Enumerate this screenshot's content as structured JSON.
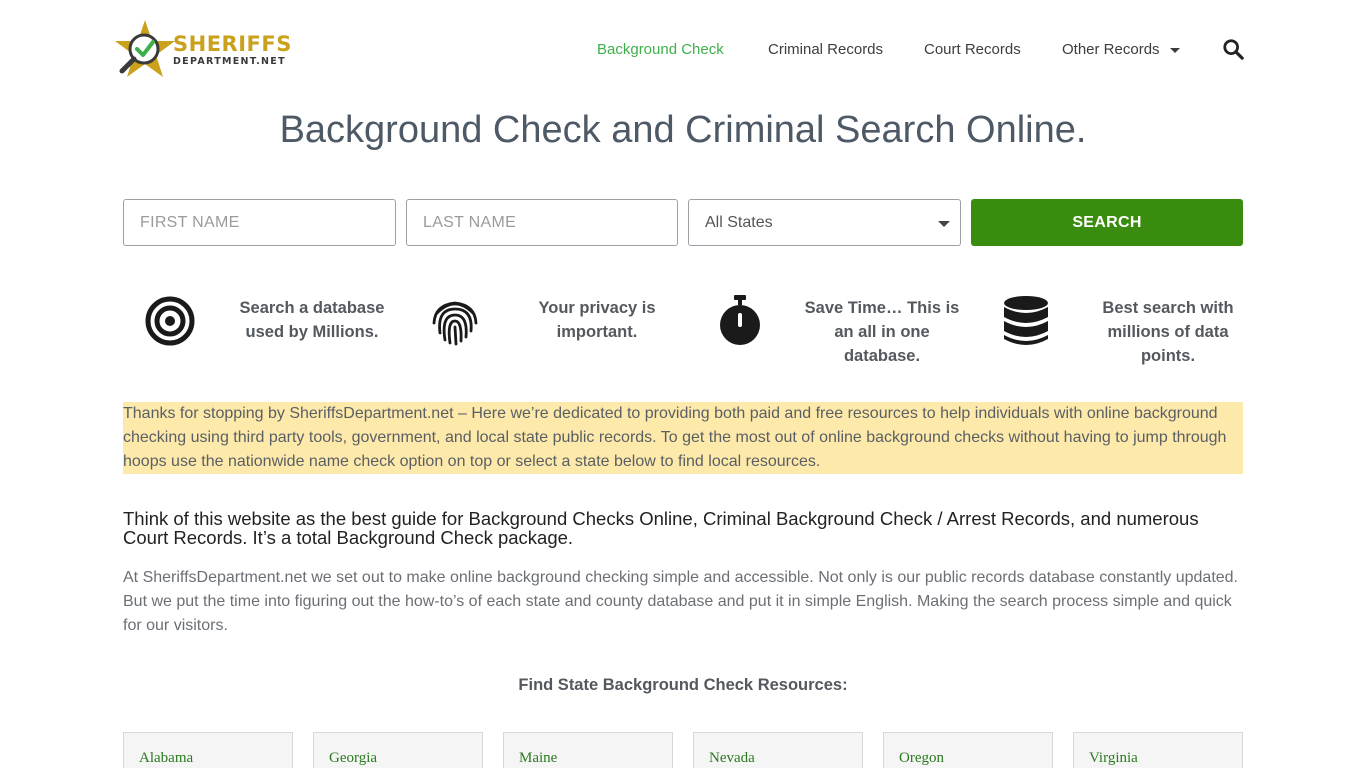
{
  "logo": {
    "main": "SHERIFFS",
    "sub": "DEPARTMENT.NET"
  },
  "nav": {
    "items": [
      {
        "label": "Background Check",
        "active": true
      },
      {
        "label": "Criminal Records",
        "active": false
      },
      {
        "label": "Court Records",
        "active": false
      },
      {
        "label": "Other Records",
        "active": false,
        "dropdown": true
      }
    ],
    "search_icon": "search-icon"
  },
  "page_title": "Background Check and Criminal Search Online.",
  "search_form": {
    "first_name_placeholder": "FIRST NAME",
    "last_name_placeholder": "LAST NAME",
    "state_selected": "All States",
    "search_label": "SEARCH"
  },
  "features": [
    {
      "icon": "target-icon",
      "text": "Search a database used by Millions."
    },
    {
      "icon": "fingerprint-icon",
      "text": "Your privacy is important."
    },
    {
      "icon": "stopwatch-icon",
      "text": "Save Time… This is an all in one database."
    },
    {
      "icon": "database-icon",
      "text": "Best search with millions of data points."
    }
  ],
  "intro_text": "Thanks for stopping by SheriffsDepartment.net – Here we’re dedicated to providing both paid and free resources to help individuals with online background checking using third party tools, government, and local state public records. To get the most out of online background checks without having to jump through hoops use the nationwide name check option on top or select a state below to find local resources.",
  "guide_heading": "Think of this website as the best guide for Background Checks Online, Criminal Background Check / Arrest Records, and numerous Court Records. It’s a total Background Check package.",
  "body_text": "At SheriffsDepartment.net we set out to make online background checking simple and accessible. Not only is our public records database constantly updated. But we put the time into figuring out the how-to’s of each state and county database and put it in simple English. Making the search process simple and quick for our visitors.",
  "states_heading": "Find State Background Check Resources:",
  "states": [
    "Alabama",
    "Georgia",
    "Maine",
    "Nevada",
    "Oregon",
    "Virginia"
  ],
  "colors": {
    "accent_green": "#3eb04a",
    "button_green": "#3a8c0f",
    "highlight": "#fde9a9",
    "logo_gold": "#caa11c"
  }
}
